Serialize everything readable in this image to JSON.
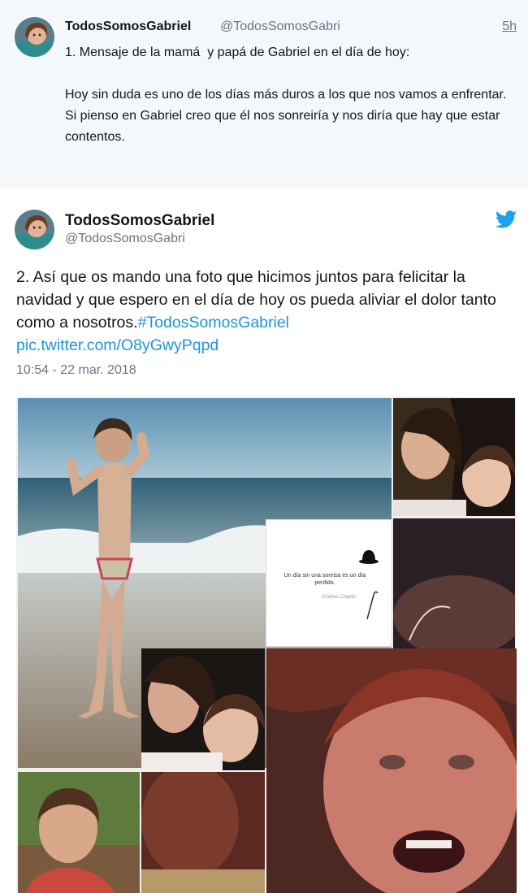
{
  "thread_tweet": {
    "display_name": "TodosSomosGabriel",
    "handle": "@TodosSomosGabri",
    "time": "5h",
    "text": "1. Mensaje de la mamá  y papá de Gabriel en el día de hoy:\n\nHoy sin duda es uno de los días más duros a los que nos vamos a enfrentar.\nSi pienso en Gabriel creo que él nos sonreiría y nos diría que hay que estar contentos."
  },
  "main_tweet": {
    "display_name": "TodosSomosGabriel",
    "handle": "@TodosSomosGabri",
    "text_part1": "2. Así que os mando una foto que hicimos juntos para felicitar la navidad y que espero en el día de hoy os pueda aliviar el dolor tanto como a nosotros.",
    "hashtag": "#TodosSomosGabriel",
    "pic_link": "pic.twitter.com/O8yGwyPqpd",
    "date": "10:54 - 22 mar. 2018"
  },
  "collage": {
    "quote_text": "Un día sin una sonrisa es un día perdido.",
    "quote_author": "Charles Chaplin"
  },
  "colors": {
    "link": "#1b95e0",
    "twitter_blue": "#1da1f2",
    "secondary_text": "#657786"
  }
}
